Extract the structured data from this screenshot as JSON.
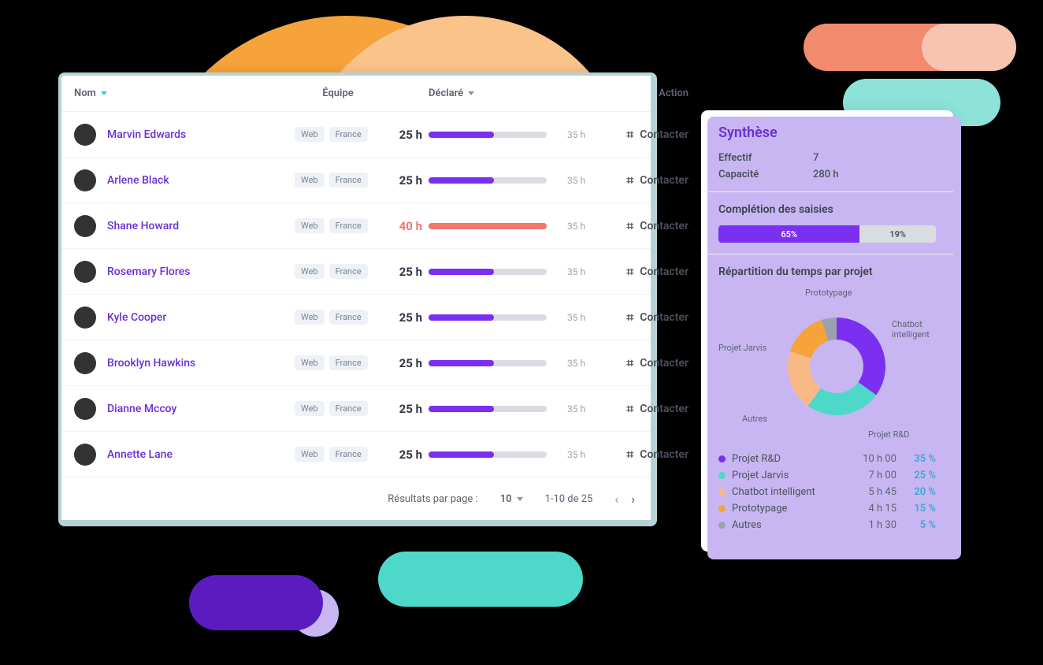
{
  "table": {
    "headers": {
      "name": "Nom",
      "team": "Équipe",
      "declared": "Déclaré",
      "action": "Action"
    },
    "tag_web": "Web",
    "tag_fr": "France",
    "rows": [
      {
        "name": "Marvin Edwards",
        "declared": "25 h",
        "pct": 55,
        "cap": "35 h",
        "over": false
      },
      {
        "name": "Arlene Black",
        "declared": "25 h",
        "pct": 55,
        "cap": "35 h",
        "over": false
      },
      {
        "name": "Shane Howard",
        "declared": "40 h",
        "pct": 100,
        "cap": "35 h",
        "over": true
      },
      {
        "name": "Rosemary Flores",
        "declared": "25 h",
        "pct": 55,
        "cap": "35 h",
        "over": false
      },
      {
        "name": "Kyle Cooper",
        "declared": "25 h",
        "pct": 55,
        "cap": "35 h",
        "over": false
      },
      {
        "name": "Brooklyn Hawkins",
        "declared": "25 h",
        "pct": 55,
        "cap": "35 h",
        "over": false
      },
      {
        "name": "Dianne Mccoy",
        "declared": "25 h",
        "pct": 55,
        "cap": "35 h",
        "over": false
      },
      {
        "name": "Annette Lane",
        "declared": "25 h",
        "pct": 55,
        "cap": "35 h",
        "over": false
      }
    ],
    "action_label": "Contacter",
    "per_page_label": "Résultats par page :",
    "per_page_value": "10",
    "range": "1-10 de 25"
  },
  "summary": {
    "title": "Synthèse",
    "effectif_label": "Effectif",
    "effectif": "7",
    "capacite_label": "Capacité",
    "capacite": "280 h",
    "completion_title": "Complétion des saisies",
    "completion_a": "65%",
    "completion_b": "19%",
    "completion_a_w": 65,
    "completion_b_w": 19,
    "repartition_title": "Répartition du temps par projet",
    "legend": [
      {
        "name": "Projet R&D",
        "h": "10 h 00",
        "p": "35 %",
        "color": "#7b2ff0"
      },
      {
        "name": "Projet Jarvis",
        "h": "7 h 00",
        "p": "25 %",
        "color": "#4ed8c9"
      },
      {
        "name": "Chatbot intelligent",
        "h": "5 h 45",
        "p": "20 %",
        "color": "#f9b987"
      },
      {
        "name": "Prototypage",
        "h": "4 h 15",
        "p": "15 %",
        "color": "#f5a33a"
      },
      {
        "name": "Autres",
        "h": "1 h 30",
        "p": "5 %",
        "color": "#9aa2ad"
      }
    ],
    "donut_labels": {
      "proto": "Prototypage",
      "chatbot": "Chatbot intelligent",
      "jarvis": "Projet Jarvis",
      "autres": "Autres",
      "rd": "Projet R&D"
    }
  },
  "chart_data": {
    "type": "pie",
    "title": "Répartition du temps par projet",
    "series": [
      {
        "name": "Projet R&D",
        "value": 35,
        "hours": "10 h 00",
        "color": "#7b2ff0"
      },
      {
        "name": "Projet Jarvis",
        "value": 25,
        "hours": "7 h 00",
        "color": "#4ed8c9"
      },
      {
        "name": "Chatbot intelligent",
        "value": 20,
        "hours": "5 h 45",
        "color": "#f9b987"
      },
      {
        "name": "Prototypage",
        "value": 15,
        "hours": "4 h 15",
        "color": "#f5a33a"
      },
      {
        "name": "Autres",
        "value": 5,
        "hours": "1 h 30",
        "color": "#9aa2ad"
      }
    ]
  }
}
